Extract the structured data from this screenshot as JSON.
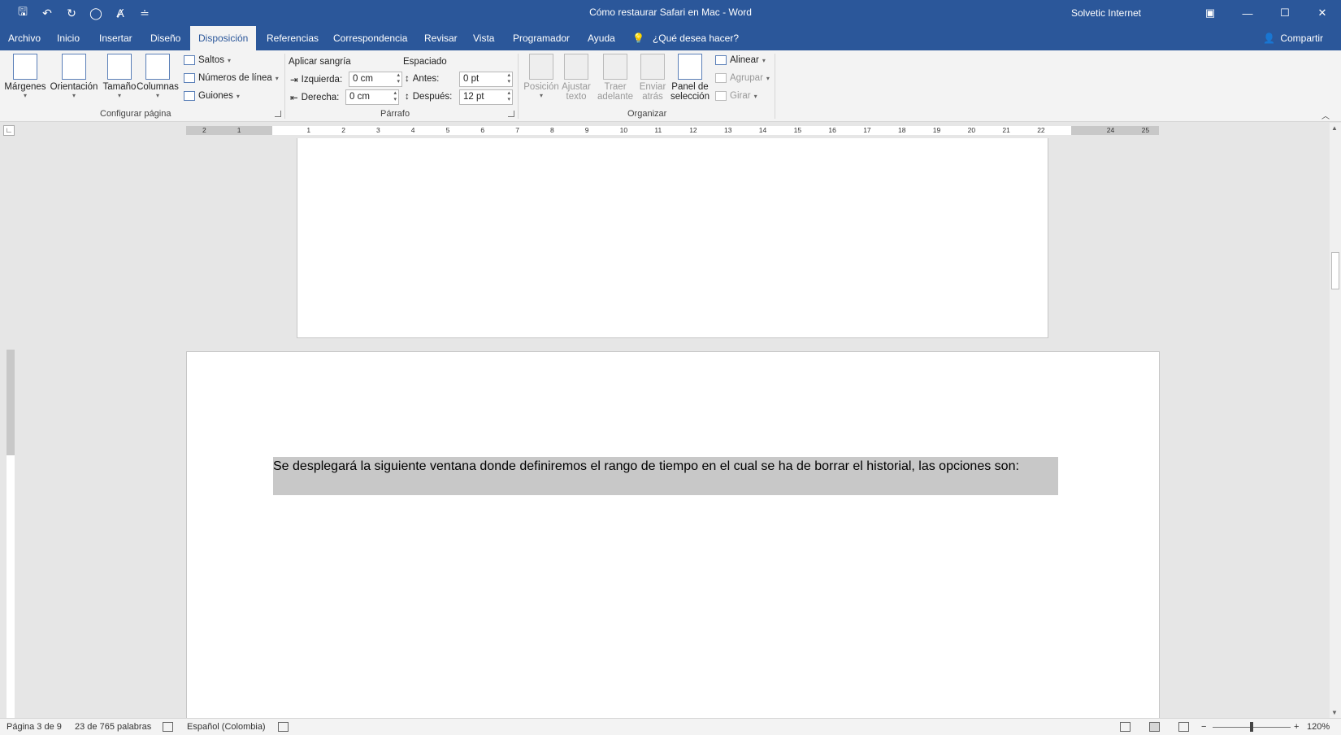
{
  "window": {
    "title": "Cómo restaurar Safari en Mac  -  Word",
    "user": "Solvetic Internet",
    "controls": [
      "ribbon-display-icon",
      "minimize-icon",
      "maximize-icon",
      "close-icon"
    ]
  },
  "qat": {
    "icons": [
      "save-icon",
      "undo-icon",
      "redo-icon",
      "circle-icon",
      "format-painter-icon",
      "customize-icon"
    ],
    "glyphs": [
      "🖫",
      "↶",
      "↻",
      "◯",
      "Ⱥ",
      "≐"
    ]
  },
  "tabs": [
    "Archivo",
    "Inicio",
    "Insertar",
    "Diseño",
    "Disposición",
    "Referencias",
    "Correspondencia",
    "Revisar",
    "Vista",
    "Programador",
    "Ayuda"
  ],
  "active_tab": "Disposición",
  "tell_me": "¿Qué desea hacer?",
  "share": "Compartir",
  "ribbon": {
    "page_setup": {
      "label": "Configurar página",
      "buttons": [
        "Márgenes",
        "Orientación",
        "Tamaño",
        "Columnas"
      ],
      "small": [
        "Saltos",
        "Números de línea",
        "Guiones"
      ]
    },
    "paragraph": {
      "label": "Párrafo",
      "indent_title": "Aplicar sangría",
      "spacing_title": "Espaciado",
      "left_label": "Izquierda:",
      "left_value": "0 cm",
      "right_label": "Derecha:",
      "right_value": "0 cm",
      "before_label": "Antes:",
      "before_value": "0 pt",
      "after_label": "Después:",
      "after_value": "12 pt"
    },
    "arrange": {
      "label": "Organizar",
      "position": [
        "Posición",
        ""
      ],
      "wrap": [
        "Ajustar",
        "texto"
      ],
      "forward": [
        "Traer",
        "adelante"
      ],
      "backward": [
        "Enviar",
        "atrás"
      ],
      "selection_pane": [
        "Panel de",
        "selección"
      ],
      "align": "Alinear",
      "group": "Agrupar",
      "rotate": "Girar"
    }
  },
  "ruler": {
    "ticks": [
      "2",
      "1",
      "",
      "1",
      "2",
      "3",
      "4",
      "5",
      "6",
      "7",
      "8",
      "9",
      "10",
      "11",
      "12",
      "13",
      "14",
      "15",
      "16",
      "17",
      "18",
      "19",
      "20",
      "21",
      "22",
      "",
      "24",
      "25"
    ]
  },
  "document": {
    "selected_paragraph": "Se desplegará la siguiente ventana donde definiremos el rango de tiempo en el cual se ha de borrar el historial, las opciones son:"
  },
  "status": {
    "page": "Página 3 de 9",
    "words": "23 de 765 palabras",
    "language": "Español (Colombia)",
    "zoom": "120%"
  }
}
